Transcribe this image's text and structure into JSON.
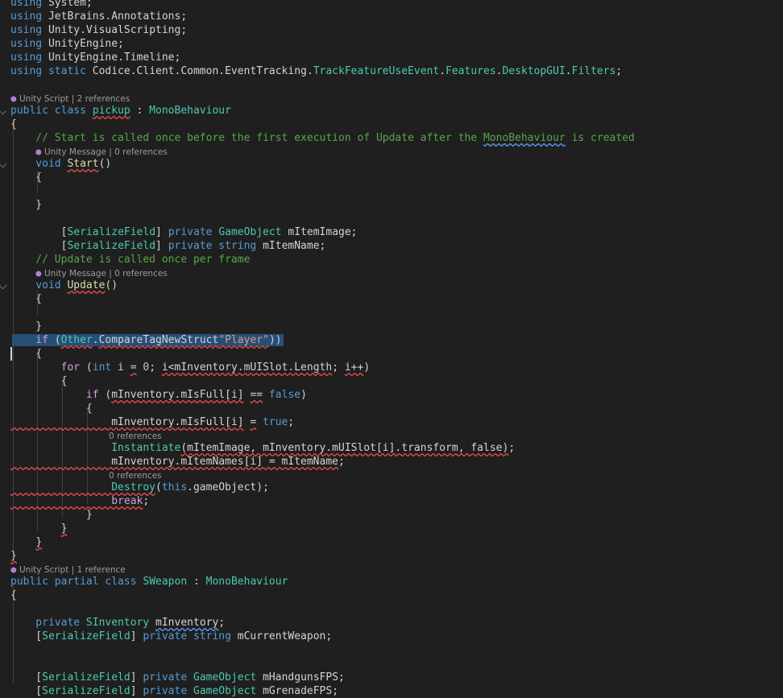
{
  "editor": {
    "language": "csharp",
    "colors": {
      "background": "#1f1f1f",
      "keyword": "#569cd6",
      "type": "#4ec9b0",
      "method": "#dcdcaa",
      "comment": "#57a64a",
      "string": "#d69d85",
      "number": "#b5cea8",
      "selection": "#264f78",
      "error_squiggle": "#f14c4c",
      "codelens": "#9d9d9d"
    },
    "codelens_icon": "unity-cube-icon",
    "lines": [
      {
        "text": "using System;",
        "tokens": [
          [
            "k",
            "using"
          ],
          [
            "p",
            " System;"
          ]
        ]
      },
      {
        "text": "using JetBrains.Annotations;",
        "tokens": [
          [
            "k",
            "using"
          ],
          [
            "p",
            " JetBrains.Annotations;"
          ]
        ]
      },
      {
        "text": "using Unity.VisualScripting;",
        "tokens": [
          [
            "k",
            "using"
          ],
          [
            "p",
            " Unity.VisualScripting;"
          ]
        ]
      },
      {
        "text": "using UnityEngine;",
        "tokens": [
          [
            "k",
            "using"
          ],
          [
            "p",
            " UnityEngine;"
          ]
        ]
      },
      {
        "text": "using UnityEngine.Timeline;",
        "tokens": [
          [
            "k",
            "using"
          ],
          [
            "p",
            " UnityEngine.Timeline;"
          ]
        ]
      },
      {
        "text": "using static Codice.Client.Common.EventTracking.TrackFeatureUseEvent.Features.DesktopGUI.Filters;",
        "tokens": [
          [
            "k",
            "using static"
          ],
          [
            "p",
            " Codice.Client.Common.EventTracking."
          ],
          [
            "t",
            "TrackFeatureUseEvent"
          ],
          [
            "p",
            "."
          ],
          [
            "t",
            "Features"
          ],
          [
            "p",
            "."
          ],
          [
            "t",
            "DesktopGUI"
          ],
          [
            "p",
            "."
          ],
          [
            "t",
            "Filters"
          ],
          [
            "p",
            ";"
          ]
        ]
      },
      {
        "text": "",
        "tokens": []
      },
      {
        "lens": "Unity Script | 2 references"
      },
      {
        "text": "public class pickup : MonoBehaviour",
        "fold": true,
        "tokens": [
          [
            "k",
            "public class"
          ],
          [
            "p",
            " "
          ],
          [
            "t err",
            "pickup"
          ],
          [
            "p",
            " : "
          ],
          [
            "t",
            "MonoBehaviour"
          ]
        ]
      },
      {
        "text": "{",
        "tokens": [
          [
            "p",
            "{"
          ]
        ]
      },
      {
        "text": "    // Start is called once before the first execution of Update after the MonoBehaviour is created",
        "tokens": [
          [
            "c",
            "    // Start is called once before the first execution of Update after the "
          ],
          [
            "c warn",
            "MonoBehaviour"
          ],
          [
            "c",
            " is created"
          ]
        ]
      },
      {
        "lens": "Unity Message | 0 references",
        "indent": 44
      },
      {
        "text": "    void Start()",
        "fold": true,
        "tokens": [
          [
            "k",
            "    void"
          ],
          [
            "p",
            " "
          ],
          [
            "m err",
            "Start"
          ],
          [
            "p",
            "()"
          ]
        ]
      },
      {
        "text": "    {",
        "tokens": [
          [
            "p",
            "    {"
          ]
        ]
      },
      {
        "text": "",
        "tokens": []
      },
      {
        "text": "    }",
        "tokens": [
          [
            "p",
            "    }"
          ]
        ]
      },
      {
        "text": "",
        "tokens": []
      },
      {
        "text": "        [SerializeField] private GameObject mItemImage;",
        "tokens": [
          [
            "p",
            "        ["
          ],
          [
            "t",
            "SerializeField"
          ],
          [
            "p",
            "] "
          ],
          [
            "k",
            "private"
          ],
          [
            "p",
            " "
          ],
          [
            "t",
            "GameObject"
          ],
          [
            "p",
            " mItemImage;"
          ]
        ]
      },
      {
        "text": "        [SerializeField] private string mItemName;",
        "tokens": [
          [
            "p",
            "        ["
          ],
          [
            "t",
            "SerializeField"
          ],
          [
            "p",
            "] "
          ],
          [
            "k",
            "private string"
          ],
          [
            "p",
            " mItemName;"
          ]
        ]
      },
      {
        "text": "    // Update is called once per frame",
        "tokens": [
          [
            "c",
            "    // Update is called once per frame"
          ]
        ]
      },
      {
        "lens": "Unity Message | 0 references",
        "indent": 44
      },
      {
        "text": "    void Update()",
        "fold": true,
        "tokens": [
          [
            "k",
            "    void"
          ],
          [
            "p",
            " "
          ],
          [
            "m err",
            "Update"
          ],
          [
            "p",
            "()"
          ]
        ]
      },
      {
        "text": "    {",
        "tokens": [
          [
            "p",
            "    {"
          ]
        ]
      },
      {
        "text": "",
        "tokens": []
      },
      {
        "text": "    }",
        "tokens": [
          [
            "p",
            "    }"
          ]
        ]
      },
      {
        "text": "    if (Other.CompareTagNewStruct\"Player\"))",
        "selected": true,
        "tokens": [
          [
            "kc",
            "    if"
          ],
          [
            "p",
            " ("
          ],
          [
            "t err",
            "Other"
          ],
          [
            "p",
            "."
          ],
          [
            "p err",
            "CompareTagNewStruct"
          ],
          [
            "s err",
            "\"Player\""
          ],
          [
            "p",
            "))"
          ]
        ]
      },
      {
        "text": "    {",
        "caret": true,
        "tokens": [
          [
            "p",
            "    {"
          ]
        ]
      },
      {
        "text": "        for (int i = 0; i<mInventory.mUISlot.Length; i++)",
        "tokens": [
          [
            "kc",
            "        for"
          ],
          [
            "p",
            " ("
          ],
          [
            "k",
            "int"
          ],
          [
            "p",
            " i "
          ],
          [
            "p err",
            "="
          ],
          [
            "p",
            " "
          ],
          [
            "n",
            "0"
          ],
          [
            "p",
            "; "
          ],
          [
            "p err",
            "i<mInventory.mUISlot.Length"
          ],
          [
            "p",
            "; "
          ],
          [
            "p err",
            "i++"
          ],
          [
            "p",
            ")"
          ]
        ]
      },
      {
        "text": "        {",
        "tokens": [
          [
            "p",
            "        {"
          ]
        ]
      },
      {
        "text": "            if (mInventory.mIsFull[i] == false)",
        "tokens": [
          [
            "kc",
            "            if"
          ],
          [
            "p",
            " ("
          ],
          [
            "p err",
            "mInventory.mIsFull[i]"
          ],
          [
            "p",
            " "
          ],
          [
            "p err",
            "=="
          ],
          [
            "p",
            " "
          ],
          [
            "k",
            "false"
          ],
          [
            "p",
            ")"
          ]
        ]
      },
      {
        "text": "            {",
        "tokens": [
          [
            "p",
            "            {"
          ]
        ]
      },
      {
        "text": "                mInventory.mIsFull[i] = true;",
        "tokens": [
          [
            "p err",
            "                mInventory.mIsFull[i]"
          ],
          [
            "p",
            " "
          ],
          [
            "p err",
            "="
          ],
          [
            "p",
            " "
          ],
          [
            "k",
            "true"
          ],
          [
            "p",
            ";"
          ]
        ]
      },
      {
        "lens": "0 references",
        "indent": 135,
        "noglyph": true
      },
      {
        "text": "                Instantiate(mItemImage, mInventory.mUISlot[i].transform, false);",
        "tokens": [
          [
            "t",
            "                Instantiate"
          ],
          [
            "p err",
            "(mItemImage, mInventory.mUISlot[i].transform, false)"
          ],
          [
            "p",
            ";"
          ]
        ]
      },
      {
        "text": "                mInventory.mItemNames[i] = mItemName;",
        "tokens": [
          [
            "p err",
            "                mInventory.mItemNames[i] = mItemName"
          ],
          [
            "p",
            ";"
          ]
        ]
      },
      {
        "lens": "0 references",
        "indent": 135,
        "noglyph": true
      },
      {
        "text": "                Destroy(this.gameObject);",
        "tokens": [
          [
            "t err",
            "                Destroy"
          ],
          [
            "p",
            "("
          ],
          [
            "k",
            "this"
          ],
          [
            "p",
            ".gameObject);"
          ]
        ]
      },
      {
        "text": "                break;",
        "tokens": [
          [
            "kc err",
            "                break"
          ],
          [
            "p",
            ";"
          ]
        ]
      },
      {
        "text": "            }",
        "tokens": [
          [
            "p",
            "            }"
          ]
        ]
      },
      {
        "text": "        }",
        "tokens": [
          [
            "p",
            "        "
          ],
          [
            "p err",
            "}"
          ]
        ]
      },
      {
        "text": "    }",
        "tokens": [
          [
            "p",
            "    "
          ],
          [
            "p err",
            "}"
          ]
        ]
      },
      {
        "text": "}",
        "tokens": [
          [
            "p err",
            "}"
          ]
        ]
      },
      {
        "lens": "Unity Script | 1 reference"
      },
      {
        "text": "public partial class SWeapon : MonoBehaviour",
        "tokens": [
          [
            "k",
            "public partial class"
          ],
          [
            "p",
            " "
          ],
          [
            "t",
            "SWeapon"
          ],
          [
            "p",
            " : "
          ],
          [
            "t",
            "MonoBehaviour"
          ]
        ]
      },
      {
        "text": "{",
        "tokens": [
          [
            "p",
            "{"
          ]
        ]
      },
      {
        "text": "",
        "tokens": []
      },
      {
        "text": "    private SInventory mInventory;",
        "tokens": [
          [
            "k",
            "    private"
          ],
          [
            "p",
            " "
          ],
          [
            "t",
            "SInventory"
          ],
          [
            "p",
            " "
          ],
          [
            "p warn",
            "mInventory"
          ],
          [
            "p",
            ";"
          ]
        ]
      },
      {
        "text": "    [SerializeField] private string mCurrentWeapon;",
        "tokens": [
          [
            "p",
            "    ["
          ],
          [
            "t",
            "SerializeField"
          ],
          [
            "p",
            "] "
          ],
          [
            "k",
            "private string"
          ],
          [
            "p",
            " mCurrentWeapon;"
          ]
        ]
      },
      {
        "text": "",
        "tokens": []
      },
      {
        "text": "",
        "tokens": []
      },
      {
        "text": "    [SerializeField] private GameObject mHandgunsFPS;",
        "tokens": [
          [
            "p",
            "    ["
          ],
          [
            "t",
            "SerializeField"
          ],
          [
            "p",
            "] "
          ],
          [
            "k",
            "private"
          ],
          [
            "p",
            " "
          ],
          [
            "t",
            "GameObject"
          ],
          [
            "p",
            " mHandgunsFPS;"
          ]
        ]
      },
      {
        "text": "    [SerializeField] private GameObject mGrenadeFPS;",
        "tokens": [
          [
            "p",
            "    ["
          ],
          [
            "t",
            "SerializeField"
          ],
          [
            "p",
            "] "
          ],
          [
            "k",
            "private"
          ],
          [
            "p",
            " "
          ],
          [
            "t",
            "GameObject"
          ],
          [
            "p",
            " mGrenadeFPS;"
          ]
        ]
      }
    ]
  }
}
